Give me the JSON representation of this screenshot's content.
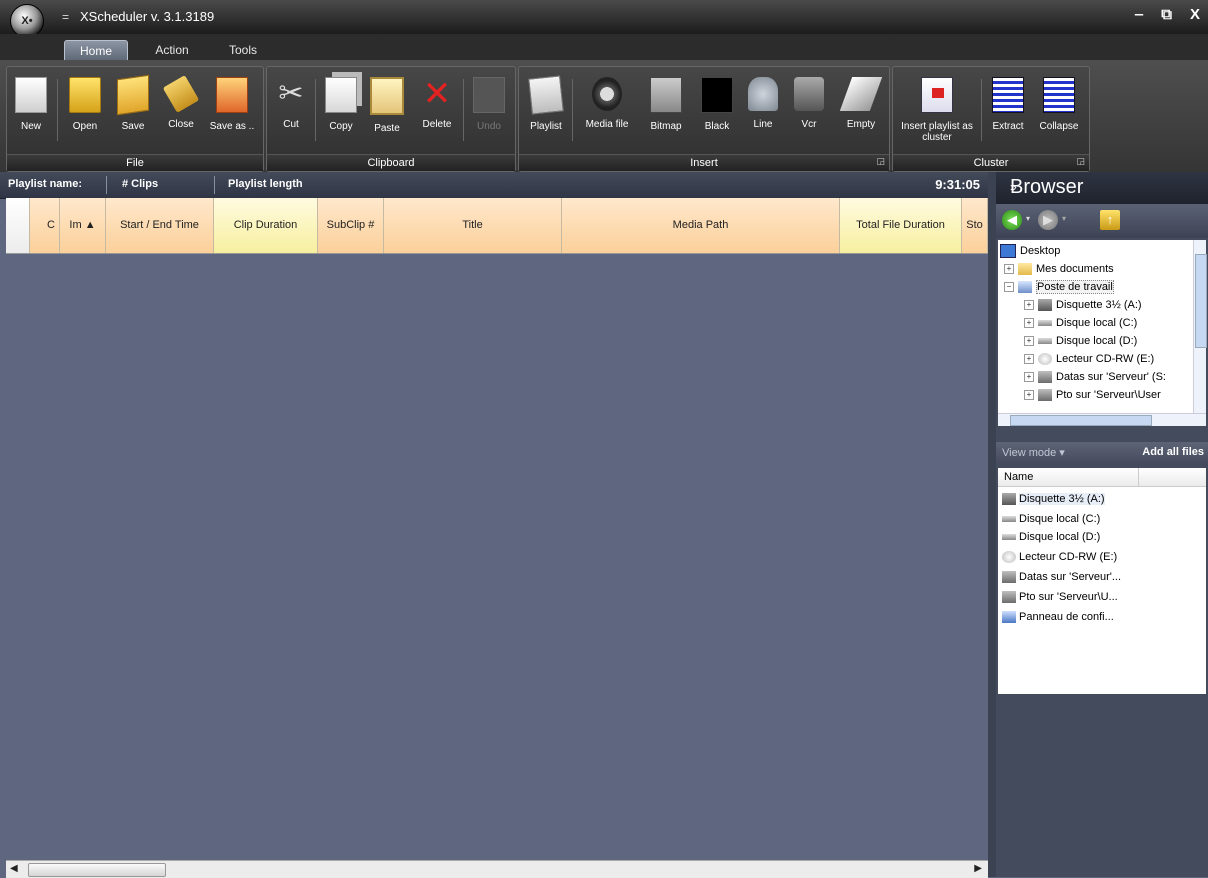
{
  "window": {
    "logo_text": "X•",
    "qat_symbol": "=",
    "title": "XScheduler v. 3.1.3189",
    "controls": [
      "‒",
      "⧉",
      "X"
    ]
  },
  "tabs": [
    {
      "label": "Home",
      "active": true
    },
    {
      "label": "Action",
      "active": false
    },
    {
      "label": "Tools",
      "active": false
    }
  ],
  "ribbon": {
    "groups": {
      "file": "File",
      "clipboard": "Clipboard",
      "insert": "Insert",
      "cluster": "Cluster"
    },
    "buttons": {
      "new": "New",
      "open": "Open",
      "save": "Save",
      "close": "Close",
      "save_as": "Save as ..",
      "cut": "Cut",
      "copy": "Copy",
      "paste": "Paste",
      "delete": "Delete",
      "undo": "Undo",
      "playlist": "Playlist",
      "media_file": "Media file",
      "bitmap": "Bitmap",
      "black": "Black",
      "line": "Line",
      "vcr": "Vcr",
      "empty": "Empty",
      "insert_playlist_cluster": "Insert playlist as cluster",
      "extract": "Extract",
      "collapse": "Collapse"
    }
  },
  "playlist_header": {
    "name_label": "Playlist name:",
    "clips_label": "# Clips",
    "length_label": "Playlist length",
    "length_value": "9:31:05"
  },
  "columns": {
    "c": "C",
    "im": "Im",
    "sort_arrow": "▲",
    "start_end": "Start / End Time",
    "clip_duration": "Clip Duration",
    "subclip": "SubClip #",
    "title": "Title",
    "media_path": "Media Path",
    "total_file_duration": "Total File Duration",
    "sto": "Sto"
  },
  "browser": {
    "title": "Browser",
    "collapse_glyph": "»",
    "tree": [
      {
        "label": "Desktop",
        "expander": ""
      },
      {
        "label": "Mes documents",
        "expander": "+"
      },
      {
        "label": "Poste de travail",
        "expander": "−"
      },
      {
        "label": "Disquette 3½ (A:)",
        "expander": "+"
      },
      {
        "label": "Disque local (C:)",
        "expander": "+"
      },
      {
        "label": "Disque local (D:)",
        "expander": "+"
      },
      {
        "label": "Lecteur CD-RW (E:)",
        "expander": "+"
      },
      {
        "label": "Datas sur 'Serveur' (S:",
        "expander": "+"
      },
      {
        "label": "Pto sur 'Serveur\\User",
        "expander": "+"
      }
    ],
    "view_mode": "View mode",
    "view_mode_arrow": "▾",
    "add_all_files": "Add all files",
    "list_header": "Name",
    "files": [
      "Disquette 3½ (A:)",
      "Disque local (C:)",
      "Disque local (D:)",
      "Lecteur CD-RW (E:)",
      "Datas sur 'Serveur'...",
      "Pto sur 'Serveur\\U...",
      "Panneau de confi..."
    ]
  }
}
